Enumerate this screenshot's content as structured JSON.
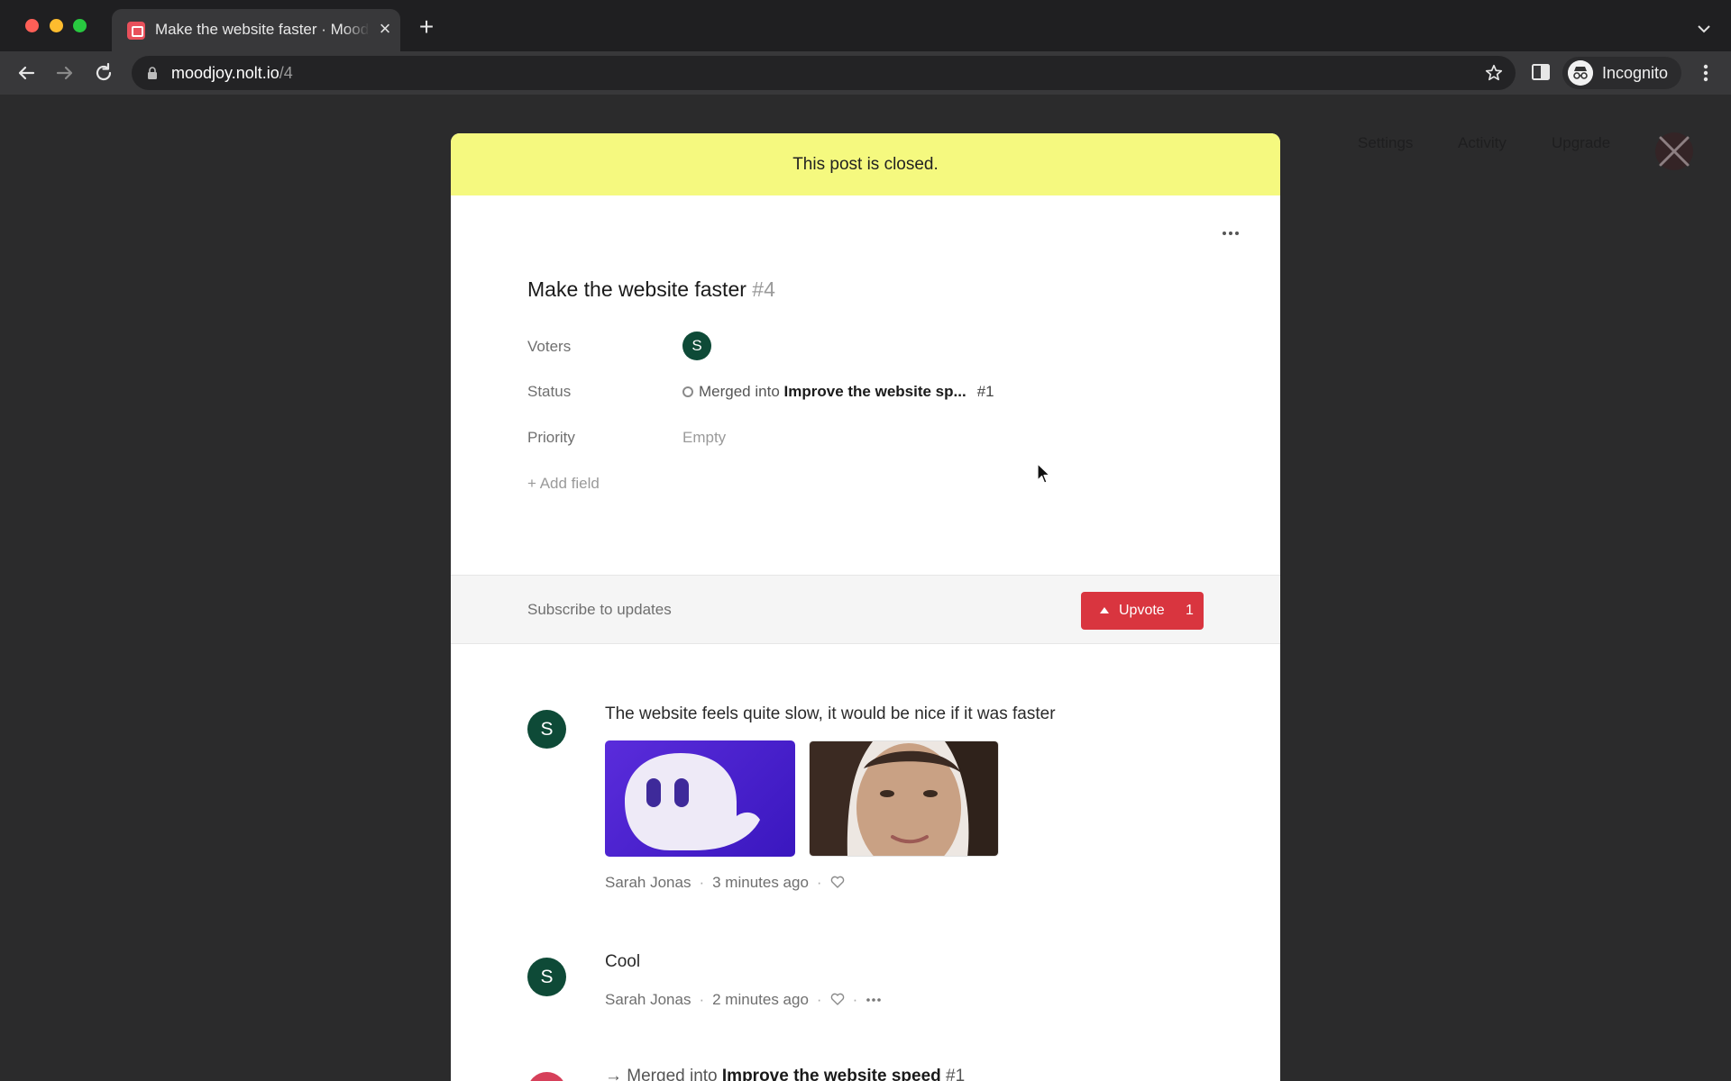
{
  "browser": {
    "tab_title": "Make the website faster · Moodjoy",
    "url_host": "moodjoy.nolt.io",
    "url_path": "/4",
    "profile_label": "Incognito"
  },
  "background_nav": {
    "items": [
      "Settings",
      "Activity",
      "Upgrade"
    ]
  },
  "post": {
    "closed_banner": "This post is closed.",
    "title": "Make the website faster",
    "number": "#4",
    "fields": {
      "voters_label": "Voters",
      "voter_initial": "S",
      "status_label": "Status",
      "status_prefix": "Merged into",
      "status_target": "Improve the website sp...",
      "status_target_number": "#1",
      "priority_label": "Priority",
      "priority_value": "Empty",
      "add_field": "+ Add field"
    },
    "subscribe_label": "Subscribe to updates",
    "upvote_label": "Upvote",
    "upvote_count": "1"
  },
  "comments": [
    {
      "avatar_initial": "S",
      "text": "The website feels quite slow, it would be nice if it was faster",
      "author": "Sarah Jonas",
      "time": "3 minutes ago"
    },
    {
      "avatar_initial": "S",
      "text": "Cool",
      "author": "Sarah Jonas",
      "time": "2 minutes ago"
    }
  ],
  "merged_event": {
    "prefix": "→ Merged into",
    "target": "Improve the website speed",
    "number": "#1"
  },
  "colors": {
    "banner": "#f5f97f",
    "upvote": "#d9353f",
    "avatar": "#0e4a37"
  }
}
